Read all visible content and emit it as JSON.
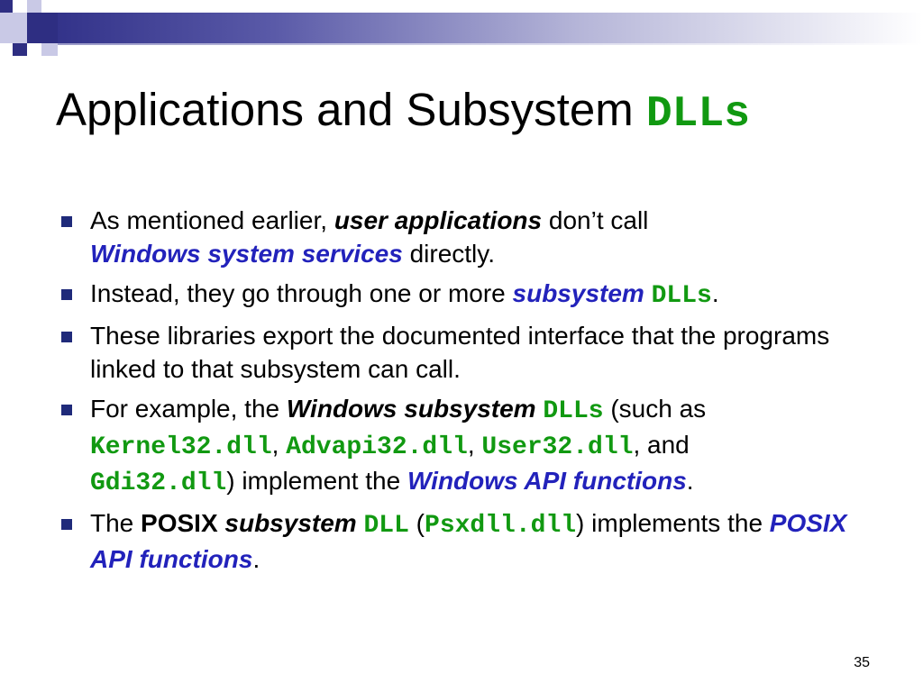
{
  "slide": {
    "title_text": "Applications and Subsystem ",
    "title_code": "DLLs",
    "page_number": "35"
  },
  "bullets": [
    {
      "t1": "As mentioned earlier, ",
      "t2": "user applications",
      "t3": " don’t call ",
      "t4": "Windows system services",
      "t5": " directly."
    },
    {
      "t1": "Instead, they go through one or more ",
      "t2": "subsystem",
      "t3": " ",
      "t4": "DLLs",
      "t5": "."
    },
    {
      "t1": "These libraries export the documented interface that the programs linked to that subsystem can call."
    },
    {
      "t1": "For example, the ",
      "t2": "Windows subsystem",
      "t3": " ",
      "t4": "DLLs",
      "t5": " (such as ",
      "t6": "Kernel32.dll",
      "t7": ", ",
      "t8": "Advapi32.dll",
      "t9": ", ",
      "t10": "User32.dll",
      "t11": ", and ",
      "t12": "Gdi32.dll",
      "t13": ") implement the ",
      "t14": "Windows API functions",
      "t15": "."
    },
    {
      "t1": "The ",
      "t2": "POSIX",
      "t3": " ",
      "t4": "subsystem",
      "t5": " ",
      "t6": "DLL",
      "t7": " (",
      "t8": "Psxdll.dll",
      "t9": ") implements the ",
      "t10": "POSIX API functions",
      "t11": "."
    }
  ],
  "colors": {
    "code_green": "#119911",
    "emphasis_blue": "#2222bb",
    "bullet_navy": "#1f2a7a",
    "band_dark": "#33338a"
  }
}
